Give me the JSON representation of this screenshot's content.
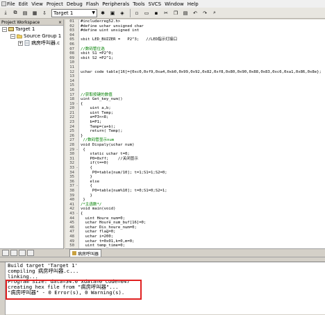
{
  "menu": [
    {
      "icon": "file-menu-icon",
      "label": "File"
    },
    {
      "label": "Edit"
    },
    {
      "label": "View"
    },
    {
      "label": "Project"
    },
    {
      "label": "Debug"
    },
    {
      "label": "Flash"
    },
    {
      "label": "Peripherals"
    },
    {
      "label": "Tools"
    },
    {
      "label": "SVCS"
    },
    {
      "label": "Window"
    },
    {
      "label": "Help"
    }
  ],
  "toolbar": {
    "target_value": "Target 1"
  },
  "sidebar": {
    "title": "Project Workspace",
    "close": "×",
    "tree": [
      {
        "label": "Target 1",
        "expander": "−"
      },
      {
        "label": "Source Group 1",
        "expander": "−"
      },
      {
        "label": "病房呼叫器.c",
        "expander": "+"
      }
    ]
  },
  "editor": {
    "tab_label": "病房呼叫器",
    "lines": [
      {
        "n": "01",
        "fold": "",
        "text": "#include<reg52.h>",
        "style": ""
      },
      {
        "n": "02",
        "fold": "",
        "text": "#define uchar unsigned char",
        "style": ""
      },
      {
        "n": "03",
        "fold": "",
        "text": "#define uint unsigned int",
        "style": ""
      },
      {
        "n": "04",
        "fold": "",
        "text": "",
        "style": ""
      },
      {
        "n": "05",
        "fold": "",
        "text": "sbit LED_BUZZER =   P2^3;   //LED指示灯接口",
        "style": ""
      },
      {
        "n": "06",
        "fold": "",
        "text": "",
        "style": ""
      },
      {
        "n": "07",
        "fold": "",
        "text": "//数码管位选",
        "style": "comment"
      },
      {
        "n": "08",
        "fold": "",
        "text": "sbit S1 =P2^0;",
        "style": ""
      },
      {
        "n": "09",
        "fold": "",
        "text": "sbit S2 =P2^1;",
        "style": ""
      },
      {
        "n": "10",
        "fold": "",
        "text": "",
        "style": ""
      },
      {
        "n": "11",
        "fold": "",
        "text": "",
        "style": ""
      },
      {
        "n": "12",
        "fold": "",
        "text": "uchar code table[16]={0xc0,0xf9,0xa4,0xb0,0x99,0x92,0x82,0xf8,0x80,0x90,0x88,0x83,0xc6,0xa1,0x86,0x8e};",
        "style": ""
      },
      {
        "n": "13",
        "fold": "",
        "text": "",
        "style": ""
      },
      {
        "n": "14",
        "fold": "",
        "text": "",
        "style": ""
      },
      {
        "n": "15",
        "fold": "",
        "text": "",
        "style": ""
      },
      {
        "n": "16",
        "fold": "",
        "text": "",
        "style": ""
      },
      {
        "n": "17",
        "fold": "",
        "text": "//获取按键的数值",
        "style": "comment"
      },
      {
        "n": "18",
        "fold": "",
        "text": "uint Get_key_num()",
        "style": ""
      },
      {
        "n": "19",
        "fold": "-",
        "text": "{",
        "style": ""
      },
      {
        "n": "20",
        "fold": "",
        "text": "    uint a,b;",
        "style": ""
      },
      {
        "n": "21",
        "fold": "",
        "text": "    uint Temp;",
        "style": ""
      },
      {
        "n": "22",
        "fold": "",
        "text": "    a=P3<<8;",
        "style": ""
      },
      {
        "n": "23",
        "fold": "",
        "text": "    b=P1;",
        "style": ""
      },
      {
        "n": "24",
        "fold": "",
        "text": "    Temp=(a+b);",
        "style": ""
      },
      {
        "n": "25",
        "fold": "",
        "text": "    return( Temp);",
        "style": ""
      },
      {
        "n": "26",
        "fold": "",
        "text": "}",
        "style": ""
      },
      {
        "n": "27",
        "fold": "",
        "text": " //数码管显示num",
        "style": "comment"
      },
      {
        "n": "28",
        "fold": "",
        "text": "void Dispaly(uchar num)",
        "style": ""
      },
      {
        "n": "29",
        "fold": "-",
        "text": " {",
        "style": ""
      },
      {
        "n": "30",
        "fold": "",
        "text": "    static uchar t=0;",
        "style": ""
      },
      {
        "n": "31",
        "fold": "",
        "text": "    P0=0xff;    //关闭显示",
        "style": ""
      },
      {
        "n": "32",
        "fold": "",
        "text": "    if(t==0)",
        "style": ""
      },
      {
        "n": "33",
        "fold": "-",
        "text": "    {",
        "style": ""
      },
      {
        "n": "34",
        "fold": "",
        "text": "     P0=table[num/10]; t=1;S1=1;S2=0;",
        "style": ""
      },
      {
        "n": "35",
        "fold": "",
        "text": "    }",
        "style": ""
      },
      {
        "n": "36",
        "fold": "",
        "text": "    else",
        "style": ""
      },
      {
        "n": "37",
        "fold": "-",
        "text": "    {",
        "style": ""
      },
      {
        "n": "38",
        "fold": "",
        "text": "     P0=table[num%10]; t=0;S1=0;S2=1;",
        "style": ""
      },
      {
        "n": "39",
        "fold": "",
        "text": "    }",
        "style": ""
      },
      {
        "n": "40",
        "fold": "",
        "text": " }",
        "style": ""
      },
      {
        "n": "41",
        "fold": "",
        "text": "/*主函数*/",
        "style": "comment"
      },
      {
        "n": "42",
        "fold": "",
        "text": "void main(void)",
        "style": ""
      },
      {
        "n": "43",
        "fold": "-",
        "text": "{",
        "style": ""
      },
      {
        "n": "44",
        "fold": "",
        "text": "  uint Houre_num=0;",
        "style": ""
      },
      {
        "n": "45",
        "fold": "",
        "text": "  uchar Houre_num_buf[16]=0;",
        "style": ""
      },
      {
        "n": "46",
        "fold": "",
        "text": "  uchar Dis_houre_num=0;",
        "style": ""
      },
      {
        "n": "47",
        "fold": "",
        "text": "  uchar flag=0;",
        "style": ""
      },
      {
        "n": "48",
        "fold": "",
        "text": "  uchar i=200;",
        "style": ""
      },
      {
        "n": "49",
        "fold": "",
        "text": "  uchar t=0x01,k=0,m=0;",
        "style": ""
      },
      {
        "n": "50",
        "fold": "",
        "text": "  uint temp_time=0;",
        "style": ""
      }
    ]
  },
  "output": {
    "lines": [
      "Build target 'Target 1'",
      "compiling 病房呼叫器.c...",
      "linking...",
      "Program Size: data=34.0 xdata=0 code=647",
      "creating hex file from \"病房呼叫器\"...",
      "\"病房呼叫器\" - 0 Error(s), 0 Warning(s)."
    ]
  },
  "colors": {
    "highlight": "#e02020",
    "comment": "#008000"
  }
}
